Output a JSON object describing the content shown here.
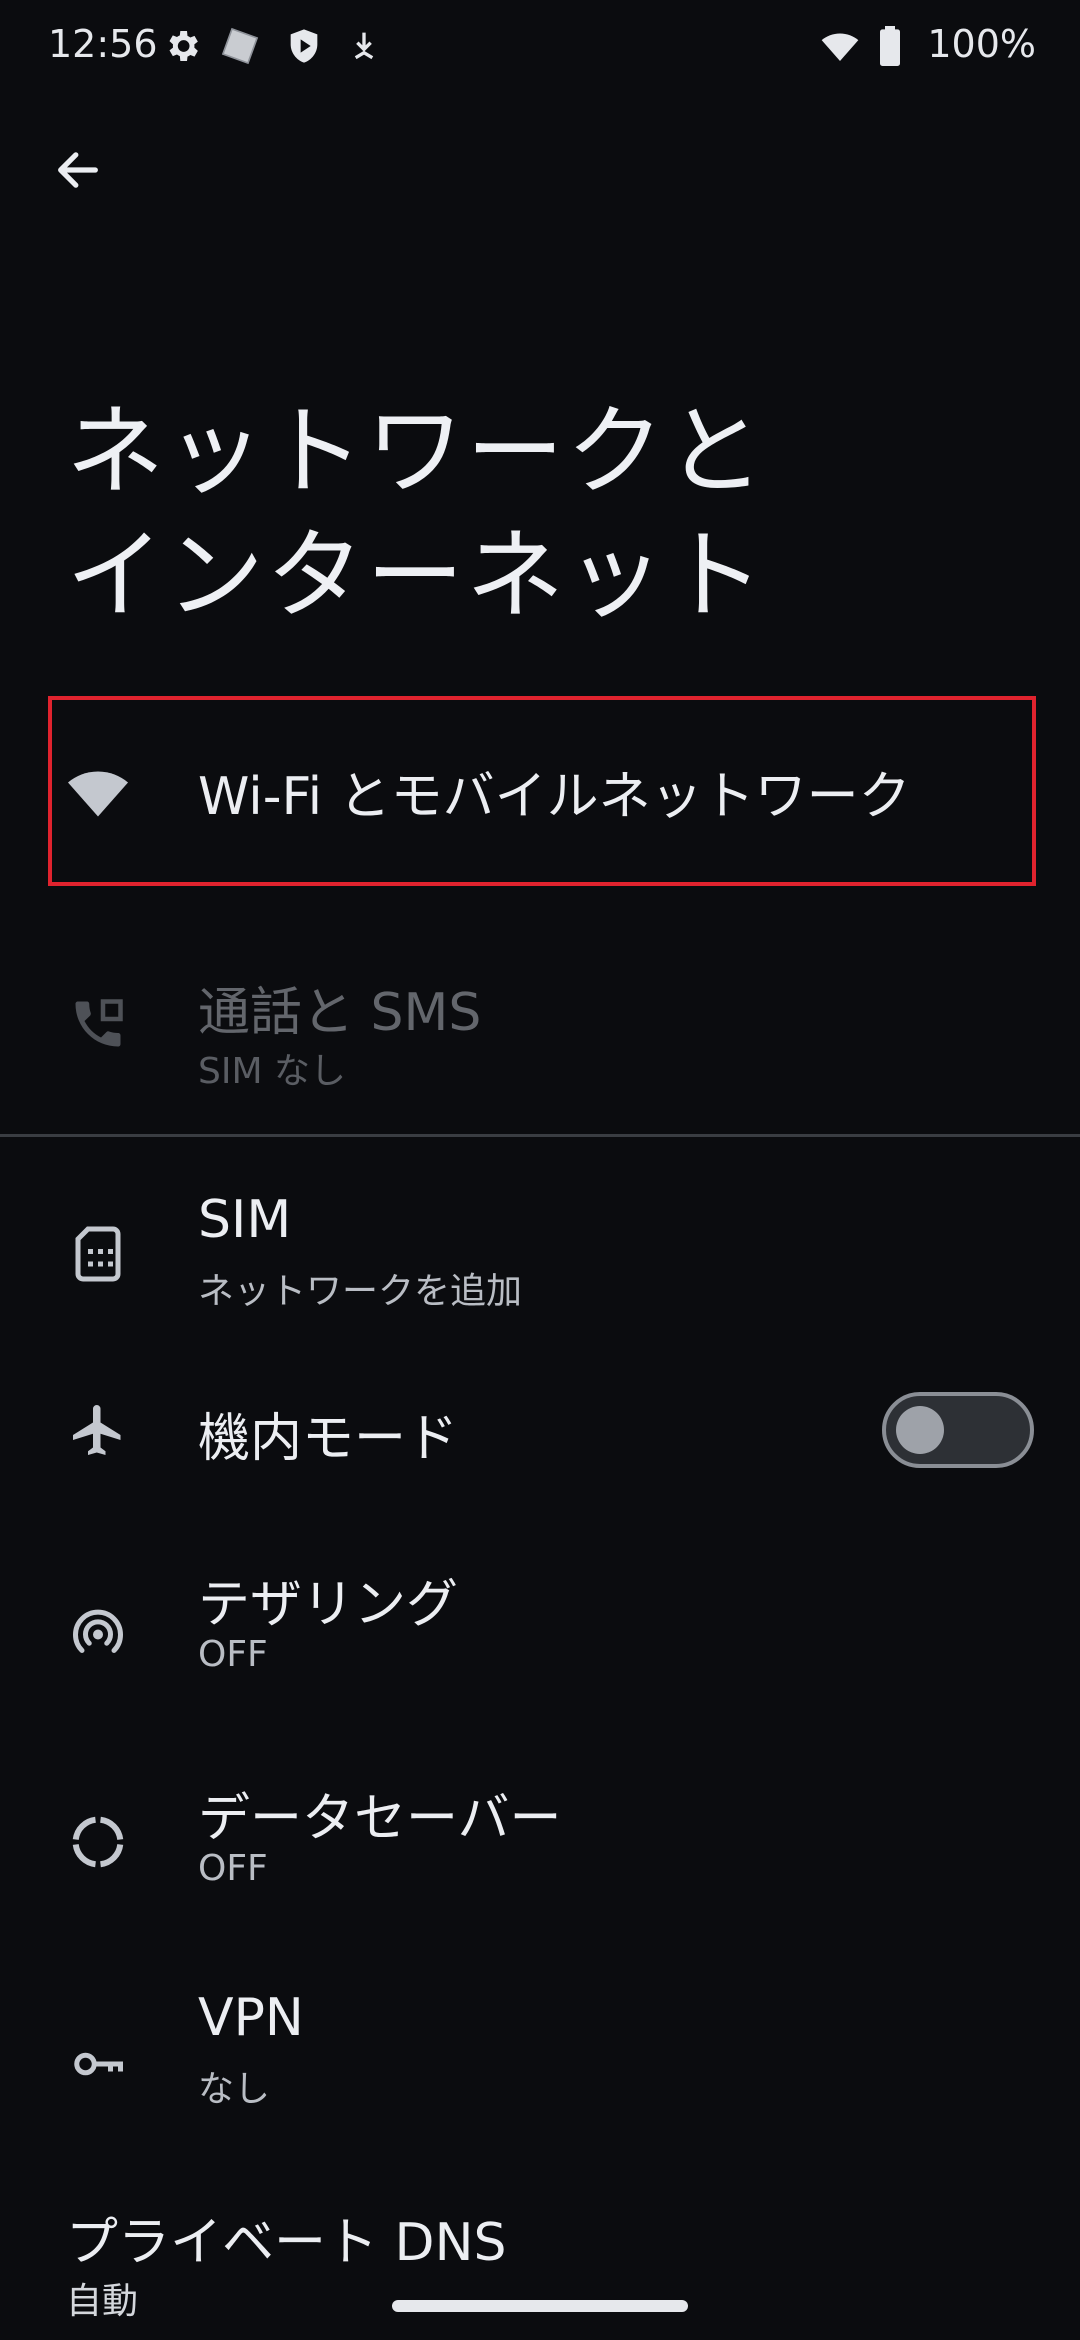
{
  "status_bar": {
    "time": "12:56",
    "battery": "100%",
    "icons": [
      "gear-icon",
      "screenshot-icon",
      "shield-play-icon",
      "download-icon",
      "wifi-icon",
      "battery-icon"
    ]
  },
  "page": {
    "title_line1": "ネットワークと",
    "title_line2": "インターネット"
  },
  "items": [
    {
      "icon": "wifi-icon",
      "title": "Wi-Fi とモバイルネットワーク",
      "subtitle": ""
    },
    {
      "icon": "call-icon",
      "title": "通話と SMS",
      "subtitle": "SIM なし",
      "disabled": true
    },
    {
      "icon": "sim-card-icon",
      "title": "SIM",
      "subtitle": "ネットワークを追加"
    },
    {
      "icon": "airplane-icon",
      "title": "機内モード",
      "subtitle": "",
      "toggle": false
    },
    {
      "icon": "hotspot-icon",
      "title": "テザリング",
      "subtitle": "OFF"
    },
    {
      "icon": "data-saver-icon",
      "title": "データセーバー",
      "subtitle": "OFF"
    },
    {
      "icon": "vpn-key-icon",
      "title": "VPN",
      "subtitle": "なし"
    },
    {
      "icon": "",
      "title": "プライベート DNS",
      "subtitle": "自動"
    }
  ],
  "colors": {
    "background": "#0b0c0f",
    "text": "#eceef2",
    "subtext": "#b9bdc4",
    "highlight": "#e0232e",
    "disabled": "#63666c"
  }
}
